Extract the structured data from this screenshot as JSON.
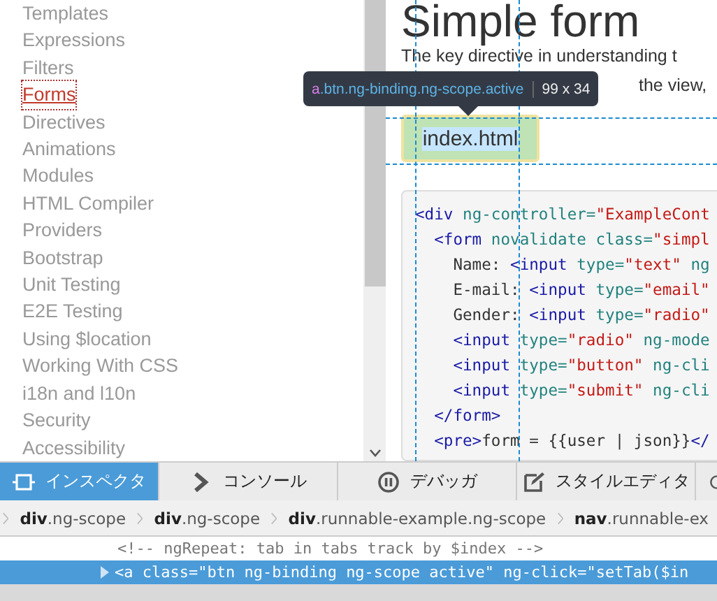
{
  "sidebar": {
    "items": [
      {
        "label": "Templates",
        "selected": false
      },
      {
        "label": "Expressions",
        "selected": false
      },
      {
        "label": "Filters",
        "selected": false
      },
      {
        "label": "Forms",
        "selected": true
      },
      {
        "label": "Directives",
        "selected": false
      },
      {
        "label": "Animations",
        "selected": false
      },
      {
        "label": "Modules",
        "selected": false
      },
      {
        "label": "HTML Compiler",
        "selected": false
      },
      {
        "label": "Providers",
        "selected": false
      },
      {
        "label": "Bootstrap",
        "selected": false
      },
      {
        "label": "Unit Testing",
        "selected": false
      },
      {
        "label": "E2E Testing",
        "selected": false
      },
      {
        "label": "Using $location",
        "selected": false
      },
      {
        "label": "Working With CSS",
        "selected": false
      },
      {
        "label": "i18n and l10n",
        "selected": false
      },
      {
        "label": "Security",
        "selected": false
      },
      {
        "label": "Accessibility",
        "selected": false
      }
    ]
  },
  "content": {
    "heading": "Simple form",
    "paragraph_line_1": "The key directive in understanding t",
    "paragraph_line_2_visible": "the view,",
    "file_tab": {
      "label": "index.html",
      "selected": true
    },
    "code_lines": [
      [
        {
          "kind": "tag",
          "text": "<div"
        },
        {
          "kind": "attr",
          "text": " ng-controller="
        },
        {
          "kind": "str",
          "text": "\"ExampleCont"
        }
      ],
      [
        {
          "kind": "tag",
          "text": "  <form"
        },
        {
          "kind": "attr",
          "text": " novalidate class="
        },
        {
          "kind": "str",
          "text": "\"simpl"
        }
      ],
      [
        {
          "kind": "plain",
          "text": "    Name: "
        },
        {
          "kind": "tag",
          "text": "<input"
        },
        {
          "kind": "attr",
          "text": " type="
        },
        {
          "kind": "str",
          "text": "\"text\""
        },
        {
          "kind": "attr",
          "text": " ng"
        }
      ],
      [
        {
          "kind": "plain",
          "text": "    E-mail: "
        },
        {
          "kind": "tag",
          "text": "<input"
        },
        {
          "kind": "attr",
          "text": " type="
        },
        {
          "kind": "str",
          "text": "\"email\""
        }
      ],
      [
        {
          "kind": "plain",
          "text": "    Gender: "
        },
        {
          "kind": "tag",
          "text": "<input"
        },
        {
          "kind": "attr",
          "text": " type="
        },
        {
          "kind": "str",
          "text": "\"radio\""
        }
      ],
      [
        {
          "kind": "tag",
          "text": "    <input"
        },
        {
          "kind": "attr",
          "text": " type="
        },
        {
          "kind": "str",
          "text": "\"radio\""
        },
        {
          "kind": "attr",
          "text": " ng-mode"
        }
      ],
      [
        {
          "kind": "tag",
          "text": "    <input"
        },
        {
          "kind": "attr",
          "text": " type="
        },
        {
          "kind": "str",
          "text": "\"button\""
        },
        {
          "kind": "attr",
          "text": " ng-cli"
        }
      ],
      [
        {
          "kind": "tag",
          "text": "    <input"
        },
        {
          "kind": "attr",
          "text": " type="
        },
        {
          "kind": "str",
          "text": "\"submit\""
        },
        {
          "kind": "attr",
          "text": " ng-cli"
        }
      ],
      [
        {
          "kind": "tag",
          "text": "  </form>"
        }
      ],
      [
        {
          "kind": "tag",
          "text": "  <pre>"
        },
        {
          "kind": "plain",
          "text": "form = {{user | json}}"
        },
        {
          "kind": "tag",
          "text": "</"
        }
      ]
    ]
  },
  "highlight_tooltip": {
    "selector": "a.btn.ng-binding.ng-scope.active",
    "size": "99 x 34"
  },
  "devtools": {
    "tabs": [
      {
        "label": "インスペクタ",
        "selected": true
      },
      {
        "label": "コンソール",
        "selected": false
      },
      {
        "label": "デバッガ",
        "selected": false
      },
      {
        "label": "スタイルエディタ",
        "selected": false
      }
    ],
    "breadcrumbs": [
      {
        "tag": "div",
        "classes": ".ng-scope"
      },
      {
        "tag": "div",
        "classes": ".ng-scope"
      },
      {
        "tag": "div",
        "classes": ".runnable-example.ng-scope"
      },
      {
        "tag": "nav",
        "classes": ".runnable-ex"
      }
    ],
    "markup": [
      {
        "text": "<!-- ngRepeat: tab in tabs track by $index -->",
        "selected": false
      },
      {
        "text": "<a class=\"btn ng-binding ng-scope active\" ng-click=\"setTab($in",
        "selected": true
      }
    ]
  }
}
